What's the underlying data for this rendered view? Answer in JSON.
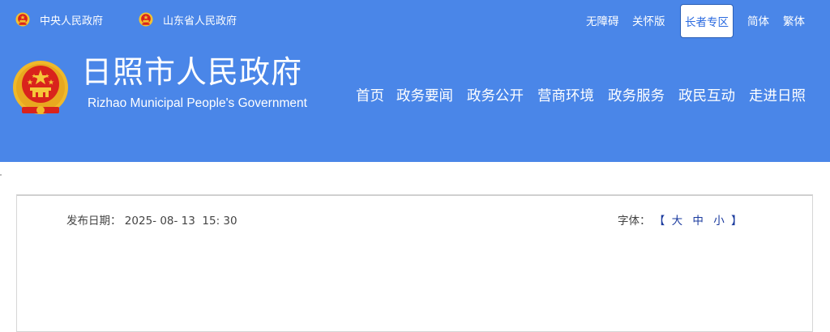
{
  "top_links": {
    "central_gov": "中央人民政府",
    "shandong_gov": "山东省人民政府"
  },
  "utility": {
    "accessibility": "无障碍",
    "care_edition": "关怀版",
    "elder_zone": "长者专区",
    "simplified": "简体",
    "traditional": "繁体"
  },
  "site": {
    "title": "日照市人民政府",
    "subtitle": "Rizhao Municipal People's Government"
  },
  "nav": {
    "items": [
      "首页",
      "政务要闻",
      "政务公开",
      "营商环境",
      "政务服务",
      "政民互动",
      "走进日照"
    ]
  },
  "article": {
    "date_label": "发布日期：",
    "date_value": "2025- 08- 13  15: 30",
    "font_label": "字体：",
    "bracket_open": "【",
    "font_large": "大",
    "font_medium": "中",
    "font_small": "小",
    "bracket_close": "】"
  },
  "colors": {
    "header_bg": "#4a86e8",
    "elder_text": "#2a6ae0",
    "font_option": "#1a3a9e"
  },
  "icons": {
    "emblem": "national-emblem-icon"
  }
}
